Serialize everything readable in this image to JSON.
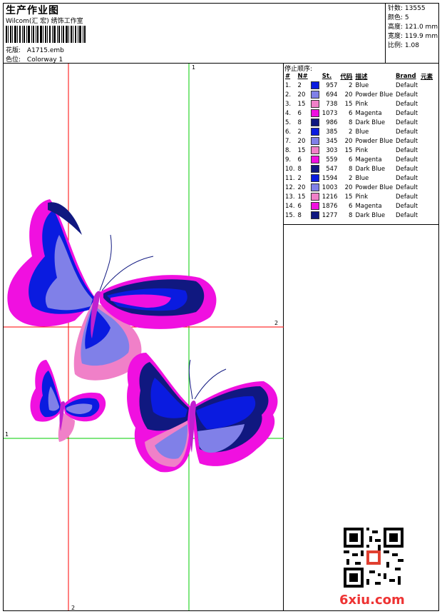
{
  "header": {
    "title": "生产作业图",
    "company": "Wilcom(汇 宏) 绣饰工作室",
    "design_label": "花版:",
    "design_value": "A1715.emb",
    "colorway_label": "色位:",
    "colorway_value": "Colorway 1"
  },
  "stats": {
    "stitches_label": "针数:",
    "stitches_value": "13555",
    "colors_label": "颜色:",
    "colors_value": "5",
    "height_label": "高度:",
    "height_value": "121.0 mm",
    "width_label": "宽度:",
    "width_value": "119.9 mm",
    "scale_label": "比例:",
    "scale_value": "1.08"
  },
  "canvas": {
    "marker_top": "1",
    "marker_right": "2",
    "marker_left": "1",
    "marker_bottom": "2",
    "axis_colors": {
      "red": "#ff0000",
      "green": "#00cc00"
    }
  },
  "sequence": {
    "title": "停止顺序:",
    "headers": [
      "#",
      "N#",
      "St.",
      "代码",
      "描述",
      "Brand",
      "元素"
    ],
    "rows": [
      {
        "n": "1.",
        "nn": "2",
        "color": "#0a1be0",
        "st": "957",
        "code": "2",
        "desc": "Blue",
        "brand": "Default"
      },
      {
        "n": "2.",
        "nn": "20",
        "color": "#8080e8",
        "st": "694",
        "code": "20",
        "desc": "Powder Blue",
        "brand": "Default"
      },
      {
        "n": "3.",
        "nn": "15",
        "color": "#f080c8",
        "st": "738",
        "code": "15",
        "desc": "Pink",
        "brand": "Default"
      },
      {
        "n": "4.",
        "nn": "6",
        "color": "#f010e0",
        "st": "1073",
        "code": "6",
        "desc": "Magenta",
        "brand": "Default"
      },
      {
        "n": "5.",
        "nn": "8",
        "color": "#101880",
        "st": "986",
        "code": "8",
        "desc": "Dark Blue",
        "brand": "Default"
      },
      {
        "n": "6.",
        "nn": "2",
        "color": "#0a1be0",
        "st": "385",
        "code": "2",
        "desc": "Blue",
        "brand": "Default"
      },
      {
        "n": "7.",
        "nn": "20",
        "color": "#8080e8",
        "st": "345",
        "code": "20",
        "desc": "Powder Blue",
        "brand": "Default"
      },
      {
        "n": "8.",
        "nn": "15",
        "color": "#f080c8",
        "st": "303",
        "code": "15",
        "desc": "Pink",
        "brand": "Default"
      },
      {
        "n": "9.",
        "nn": "6",
        "color": "#f010e0",
        "st": "559",
        "code": "6",
        "desc": "Magenta",
        "brand": "Default"
      },
      {
        "n": "10.",
        "nn": "8",
        "color": "#101880",
        "st": "547",
        "code": "8",
        "desc": "Dark Blue",
        "brand": "Default"
      },
      {
        "n": "11.",
        "nn": "2",
        "color": "#0a1be0",
        "st": "1594",
        "code": "2",
        "desc": "Blue",
        "brand": "Default"
      },
      {
        "n": "12.",
        "nn": "20",
        "color": "#8080e8",
        "st": "1003",
        "code": "20",
        "desc": "Powder Blue",
        "brand": "Default"
      },
      {
        "n": "13.",
        "nn": "15",
        "color": "#f080c8",
        "st": "1216",
        "code": "15",
        "desc": "Pink",
        "brand": "Default"
      },
      {
        "n": "14.",
        "nn": "6",
        "color": "#f010e0",
        "st": "1876",
        "code": "6",
        "desc": "Magenta",
        "brand": "Default"
      },
      {
        "n": "15.",
        "nn": "8",
        "color": "#101880",
        "st": "1277",
        "code": "8",
        "desc": "Dark Blue",
        "brand": "Default"
      }
    ]
  },
  "qr_icon": "qr-code-icon",
  "watermark": "6xiu.com"
}
